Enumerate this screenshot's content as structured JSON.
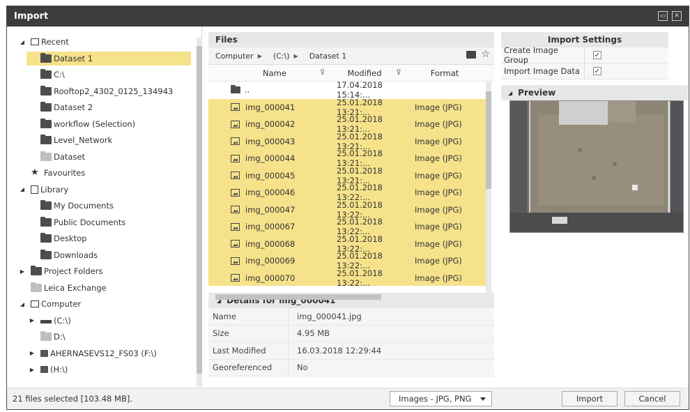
{
  "window": {
    "title": "Import",
    "controls": [
      "restore-icon",
      "close-icon"
    ]
  },
  "tree": {
    "items": [
      {
        "label": "Recent",
        "level": 0,
        "expander": "expanded",
        "icon": "monitor-icon"
      },
      {
        "label": "Dataset 1",
        "level": 1,
        "icon": "folder-icon",
        "selected": true
      },
      {
        "label": "C:\\",
        "level": 1,
        "icon": "folder-icon"
      },
      {
        "label": "Rooftop2_4302_0125_134943",
        "level": 1,
        "icon": "folder-icon"
      },
      {
        "label": "Dataset 2",
        "level": 1,
        "icon": "folder-icon"
      },
      {
        "label": "workflow (Selection)",
        "level": 1,
        "icon": "folder-icon"
      },
      {
        "label": "Level_Network",
        "level": 1,
        "icon": "folder-icon"
      },
      {
        "label": "Dataset",
        "level": 1,
        "icon": "folder-light-icon"
      },
      {
        "label": "Favourites",
        "level": 0,
        "icon": "star-icon"
      },
      {
        "label": "Library",
        "level": 0,
        "expander": "expanded",
        "icon": "library-icon"
      },
      {
        "label": "My Documents",
        "level": 1,
        "icon": "folder-icon"
      },
      {
        "label": "Public Documents",
        "level": 1,
        "icon": "folder-icon"
      },
      {
        "label": "Desktop",
        "level": 1,
        "icon": "folder-icon"
      },
      {
        "label": "Downloads",
        "level": 1,
        "icon": "folder-icon"
      },
      {
        "label": "Project Folders",
        "level": 0,
        "expander": "collapsed",
        "icon": "folder-icon"
      },
      {
        "label": "Leica Exchange",
        "level": 0,
        "icon": "exchange-icon"
      },
      {
        "label": "Computer",
        "level": 0,
        "expander": "expanded",
        "icon": "monitor-icon"
      },
      {
        "label": "(C:\\)",
        "level": 1,
        "expander": "collapsed",
        "icon": "drive-icon"
      },
      {
        "label": "D:\\",
        "level": 1,
        "icon": "drive-light-icon"
      },
      {
        "label": "AHERNASEVS12_FS03 (F:\\)",
        "level": 1,
        "expander": "collapsed",
        "icon": "network-drive-icon"
      },
      {
        "label": "(H:\\)",
        "level": 1,
        "expander": "collapsed",
        "icon": "network-drive-icon"
      }
    ]
  },
  "files": {
    "header": "Files",
    "breadcrumb": [
      "Computer",
      "(C:\\)",
      "Dataset 1"
    ],
    "columns": {
      "name": "Name",
      "modified": "Modified",
      "format": "Format"
    },
    "rows": [
      {
        "name": "..",
        "modified": "17.04.2018 15:14:...",
        "format": "",
        "icon": "folder-icon",
        "selected": false
      },
      {
        "name": "img_000041",
        "modified": "25.01.2018 13:21:...",
        "format": "Image (JPG)",
        "icon": "image-icon",
        "selected": true
      },
      {
        "name": "img_000042",
        "modified": "25.01.2018 13:21:...",
        "format": "Image (JPG)",
        "icon": "image-icon",
        "selected": true
      },
      {
        "name": "img_000043",
        "modified": "25.01.2018 13:21:...",
        "format": "Image (JPG)",
        "icon": "image-icon",
        "selected": true
      },
      {
        "name": "img_000044",
        "modified": "25.01.2018 13:21:...",
        "format": "Image (JPG)",
        "icon": "image-icon",
        "selected": true
      },
      {
        "name": "img_000045",
        "modified": "25.01.2018 13:21:...",
        "format": "Image (JPG)",
        "icon": "image-icon",
        "selected": true
      },
      {
        "name": "img_000046",
        "modified": "25.01.2018 13:22:...",
        "format": "Image (JPG)",
        "icon": "image-icon",
        "selected": true
      },
      {
        "name": "img_000047",
        "modified": "25.01.2018 13:22:...",
        "format": "Image (JPG)",
        "icon": "image-icon",
        "selected": true
      },
      {
        "name": "img_000067",
        "modified": "25.01.2018 13:22:...",
        "format": "Image (JPG)",
        "icon": "image-icon",
        "selected": true
      },
      {
        "name": "img_000068",
        "modified": "25.01.2018 13:22:...",
        "format": "Image (JPG)",
        "icon": "image-icon",
        "selected": true
      },
      {
        "name": "img_000069",
        "modified": "25.01.2018 13:22:...",
        "format": "Image (JPG)",
        "icon": "image-icon",
        "selected": true
      },
      {
        "name": "img_000070",
        "modified": "25.01.2018 13:22:...",
        "format": "Image (JPG)",
        "icon": "image-icon",
        "selected": true
      }
    ]
  },
  "details": {
    "header": "Details for img_000041",
    "rows": [
      {
        "key": "Name",
        "value": "img_000041.jpg"
      },
      {
        "key": "Size",
        "value": "4.95 MB"
      },
      {
        "key": "Last Modified",
        "value": "16.03.2018 12:29:44"
      },
      {
        "key": "Georeferenced",
        "value": "No"
      }
    ]
  },
  "settings": {
    "header": "Import Settings",
    "rows": [
      {
        "label": "Create Image Group",
        "checked": true
      },
      {
        "label": "Import Image Data",
        "checked": true
      }
    ]
  },
  "preview": {
    "header": "Preview"
  },
  "footer": {
    "status": "21 files selected [103.48 MB].",
    "filter": "Images - JPG, PNG",
    "import_label": "Import",
    "cancel_label": "Cancel"
  },
  "colors": {
    "selection": "#f6e28b",
    "titlebar": "#3c3c3c"
  }
}
